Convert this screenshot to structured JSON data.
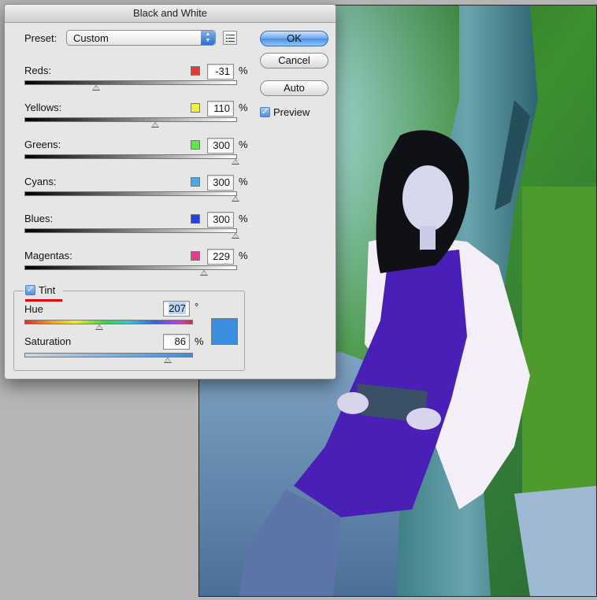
{
  "dialog": {
    "title": "Black and White",
    "preset_label": "Preset:",
    "preset_value": "Custom",
    "buttons": {
      "ok": "OK",
      "cancel": "Cancel",
      "auto": "Auto"
    },
    "preview_label": "Preview",
    "preview_checked": true,
    "sliders": [
      {
        "label": "Reds:",
        "value": "-31",
        "unit": "%",
        "swatch": "#e03b2e",
        "position": 0.34
      },
      {
        "label": "Yellows:",
        "value": "110",
        "unit": "%",
        "swatch": "#f4ef3b",
        "position": 0.62
      },
      {
        "label": "Greens:",
        "value": "300",
        "unit": "%",
        "swatch": "#5fe64b",
        "position": 1.0
      },
      {
        "label": "Cyans:",
        "value": "300",
        "unit": "%",
        "swatch": "#4aa8ee",
        "position": 1.0
      },
      {
        "label": "Blues:",
        "value": "300",
        "unit": "%",
        "swatch": "#2242e6",
        "position": 1.0
      },
      {
        "label": "Magentas:",
        "value": "229",
        "unit": "%",
        "swatch": "#e23e90",
        "position": 0.85
      }
    ],
    "tint": {
      "label": "Tint",
      "checked": true,
      "hue_label": "Hue",
      "hue_value": "207",
      "hue_unit": "°",
      "hue_position": 0.45,
      "saturation_label": "Saturation",
      "saturation_value": "86",
      "saturation_unit": "%",
      "saturation_position": 0.86,
      "color": "#3a8ee2"
    }
  },
  "photo": {
    "description_icon": "photo-woman-tree-icon"
  }
}
